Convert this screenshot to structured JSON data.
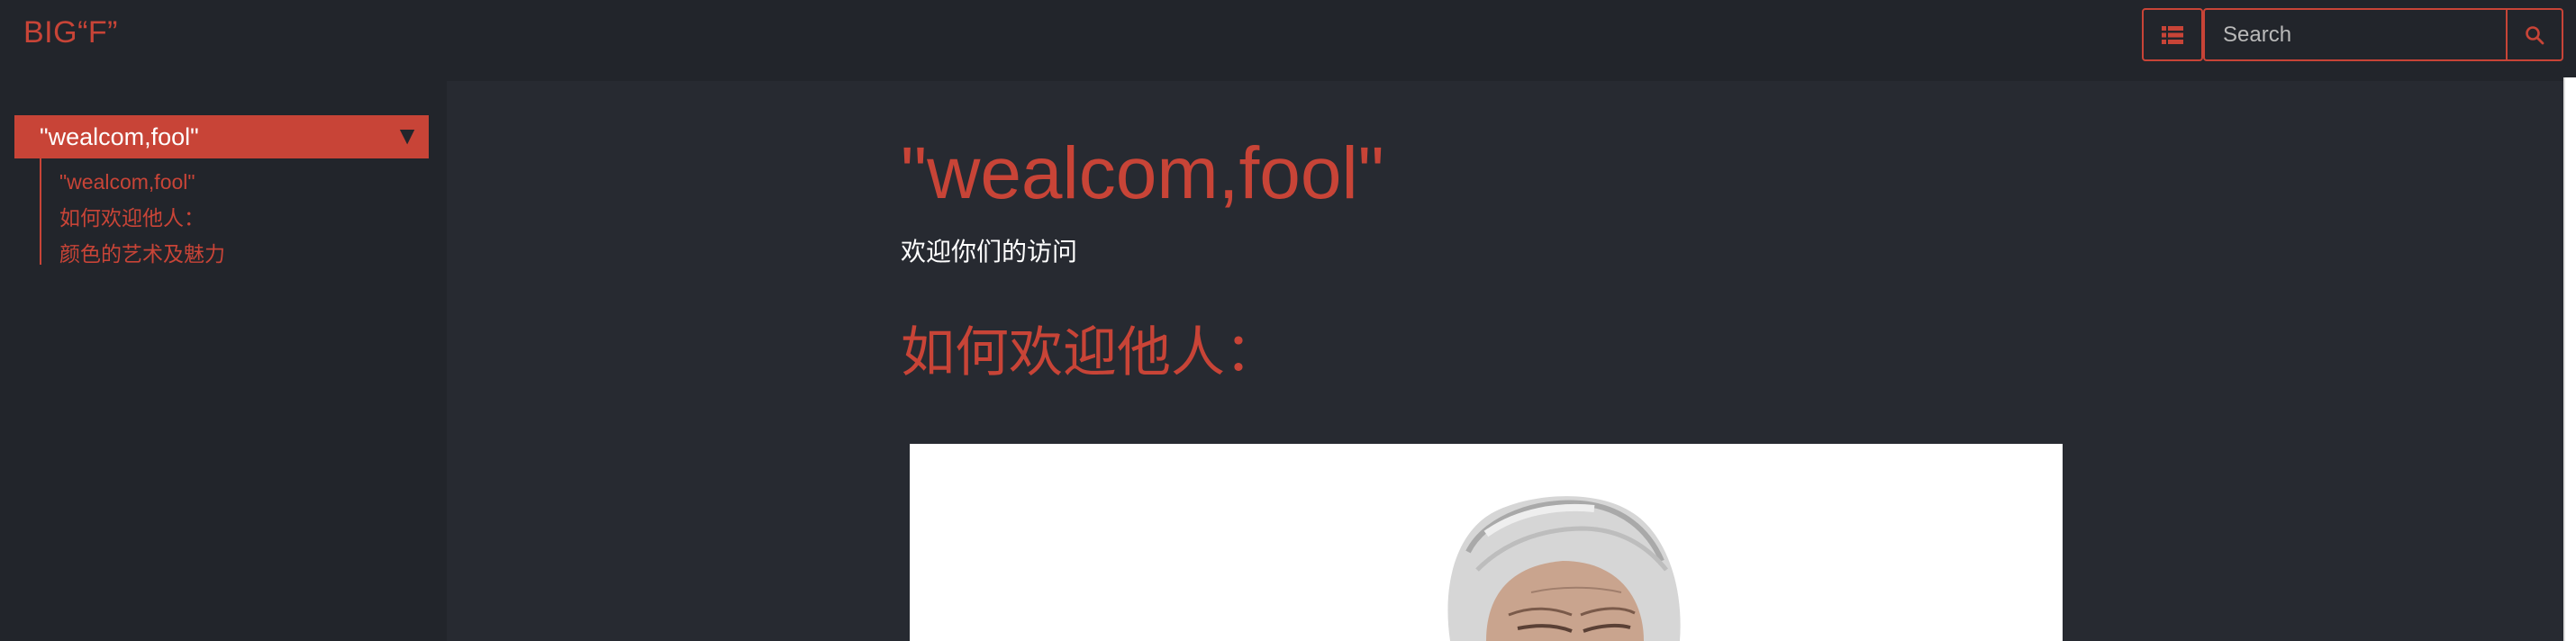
{
  "header": {
    "brand": "BIG“F”",
    "search": {
      "placeholder": "Search",
      "value": ""
    },
    "toc_icon": "list-icon",
    "search_icon": "search-icon"
  },
  "sidebar": {
    "current": "\"wealcom,fool\"",
    "items": [
      {
        "label": "\"wealcom,fool\""
      },
      {
        "label": "如何欢迎他人："
      },
      {
        "label": "颜色的艺术及魅力"
      }
    ]
  },
  "content": {
    "title": "\"wealcom,fool\"",
    "subtitle": "欢迎你们的访问",
    "section_heading": "如何欢迎他人："
  },
  "colors": {
    "accent": "#c84437",
    "header_bg": "#22252b",
    "page_bg": "#272a31",
    "text_light": "#ffffff"
  }
}
